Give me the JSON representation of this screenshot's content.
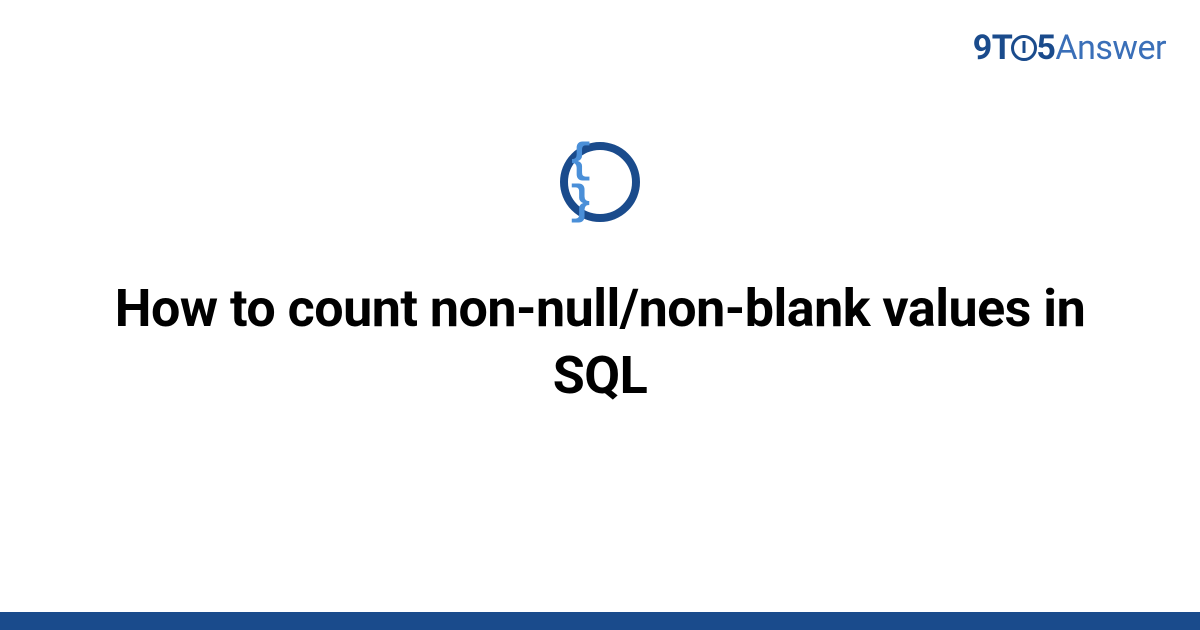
{
  "logo": {
    "part_9t": "9T",
    "part_5": "5",
    "part_answer": "Answer"
  },
  "icon": {
    "braces": "{ }"
  },
  "title": "How to count non-null/non-blank values in SQL",
  "colors": {
    "brand_dark": "#1a4b8c",
    "brand_light": "#3a6fb8",
    "icon_inner": "#4a8fd8"
  }
}
